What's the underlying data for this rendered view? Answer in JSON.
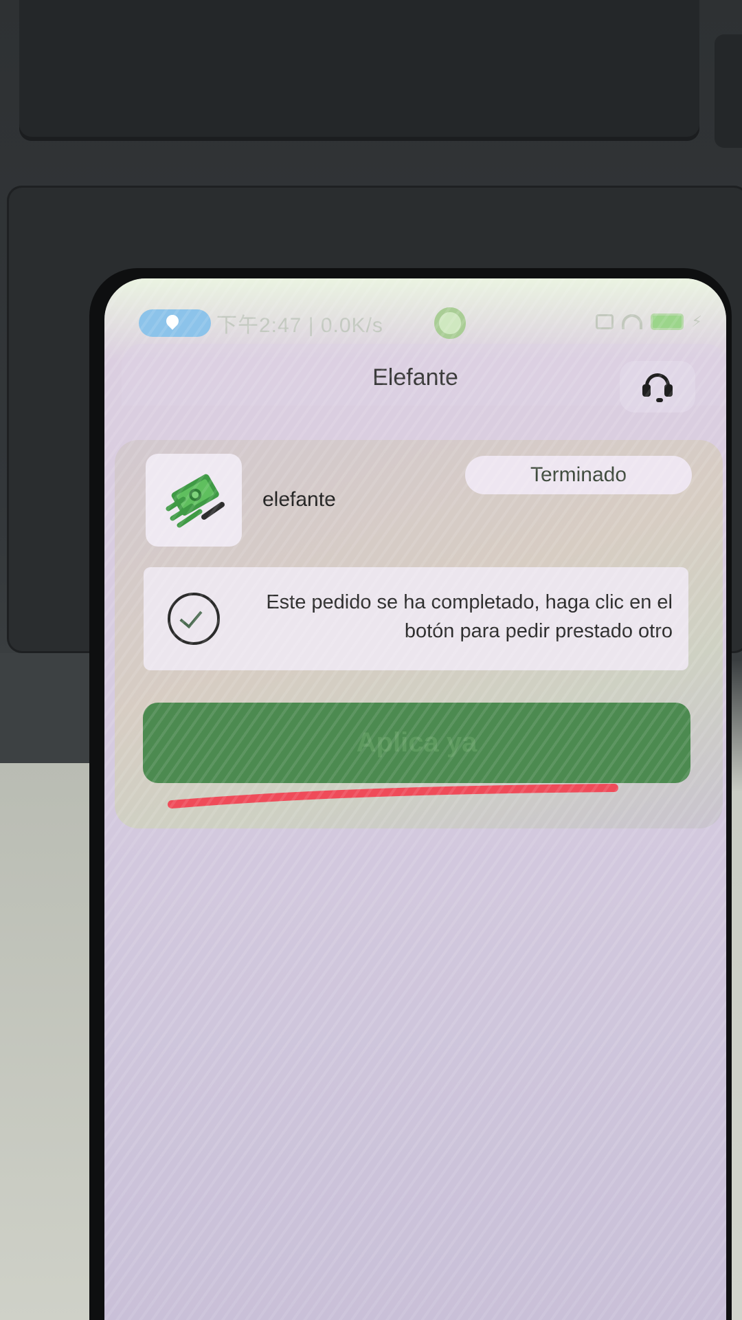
{
  "status_bar": {
    "time": "下午2:47 | 0.0K/s"
  },
  "header": {
    "title": "Elefante"
  },
  "order": {
    "app_name": "elefante",
    "status": "Terminado",
    "notice": "Este pedido se ha completado, haga clic en el botón para pedir prestado otro",
    "apply_button": "Aplica ya"
  },
  "colors": {
    "button_green": "#4c8a50",
    "annotation_red": "#ef4b59"
  }
}
